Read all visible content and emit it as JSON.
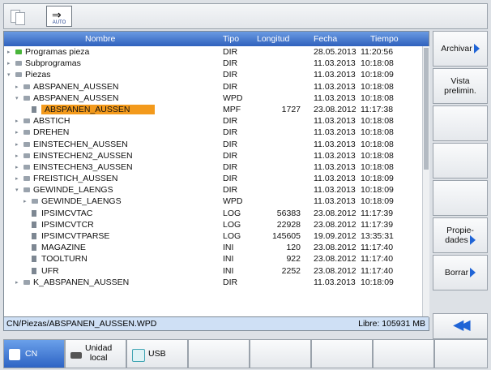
{
  "toolbar": {
    "mode_label": "AUTO"
  },
  "columns": {
    "name": "Nombre",
    "type": "Tipo",
    "length": "Longitud",
    "date": "Fecha",
    "time": "Tiempo"
  },
  "rows": [
    {
      "name": "Programas pieza",
      "type": "DIR",
      "length": "",
      "date": "28.05.2013",
      "time": "11:20:56"
    },
    {
      "name": "Subprogramas",
      "type": "DIR",
      "length": "",
      "date": "11.03.2013",
      "time": "10:18:08"
    },
    {
      "name": "Piezas",
      "type": "DIR",
      "length": "",
      "date": "11.03.2013",
      "time": "10:18:09"
    },
    {
      "name": "ABSPANEN_AUSSEN",
      "type": "DIR",
      "length": "",
      "date": "11.03.2013",
      "time": "10:18:08"
    },
    {
      "name": "ABSPANEN_AUSSEN",
      "type": "WPD",
      "length": "",
      "date": "11.03.2013",
      "time": "10:18:08"
    },
    {
      "name": "ABSPANEN_AUSSEN",
      "type": "MPF",
      "length": "1727",
      "date": "23.08.2012",
      "time": "11:17:38"
    },
    {
      "name": "ABSTICH",
      "type": "DIR",
      "length": "",
      "date": "11.03.2013",
      "time": "10:18:08"
    },
    {
      "name": "DREHEN",
      "type": "DIR",
      "length": "",
      "date": "11.03.2013",
      "time": "10:18:08"
    },
    {
      "name": "EINSTECHEN_AUSSEN",
      "type": "DIR",
      "length": "",
      "date": "11.03.2013",
      "time": "10:18:08"
    },
    {
      "name": "EINSTECHEN2_AUSSEN",
      "type": "DIR",
      "length": "",
      "date": "11.03.2013",
      "time": "10:18:08"
    },
    {
      "name": "EINSTECHEN3_AUSSEN",
      "type": "DIR",
      "length": "",
      "date": "11.03.2013",
      "time": "10:18:08"
    },
    {
      "name": "FREISTICH_AUSSEN",
      "type": "DIR",
      "length": "",
      "date": "11.03.2013",
      "time": "10:18:09"
    },
    {
      "name": "GEWINDE_LAENGS",
      "type": "DIR",
      "length": "",
      "date": "11.03.2013",
      "time": "10:18:09"
    },
    {
      "name": "GEWINDE_LAENGS",
      "type": "WPD",
      "length": "",
      "date": "11.03.2013",
      "time": "10:18:09"
    },
    {
      "name": "IPSIMCVTAC",
      "type": "LOG",
      "length": "56383",
      "date": "23.08.2012",
      "time": "11:17:39"
    },
    {
      "name": "IPSIMCVTCR",
      "type": "LOG",
      "length": "22928",
      "date": "23.08.2012",
      "time": "11:17:39"
    },
    {
      "name": "IPSIMCVTPARSE",
      "type": "LOG",
      "length": "145605",
      "date": "19.09.2012",
      "time": "13:35:31"
    },
    {
      "name": "MAGAZINE",
      "type": "INI",
      "length": "120",
      "date": "23.08.2012",
      "time": "11:17:40"
    },
    {
      "name": "TOOLTURN",
      "type": "INI",
      "length": "922",
      "date": "23.08.2012",
      "time": "11:17:40"
    },
    {
      "name": "UFR",
      "type": "INI",
      "length": "2252",
      "date": "23.08.2012",
      "time": "11:17:40"
    },
    {
      "name": "K_ABSPANEN_AUSSEN",
      "type": "DIR",
      "length": "",
      "date": "11.03.2013",
      "time": "10:18:09"
    }
  ],
  "status": {
    "path": "CN/Piezas/ABSPANEN_AUSSEN.WPD",
    "free": "Libre: 105931 MB"
  },
  "softkeys": {
    "archive": "Archivar",
    "preview_1": "Vista",
    "preview_2": "prelimin.",
    "props_1": "Propie-",
    "props_2": "dades",
    "delete": "Borrar"
  },
  "bottom": {
    "cn": "CN",
    "local_1": "Unidad",
    "local_2": "local",
    "usb": "USB"
  },
  "colors": {
    "header": "#2f61bd",
    "selection": "#f39a1c",
    "accent": "#1f64d6"
  }
}
